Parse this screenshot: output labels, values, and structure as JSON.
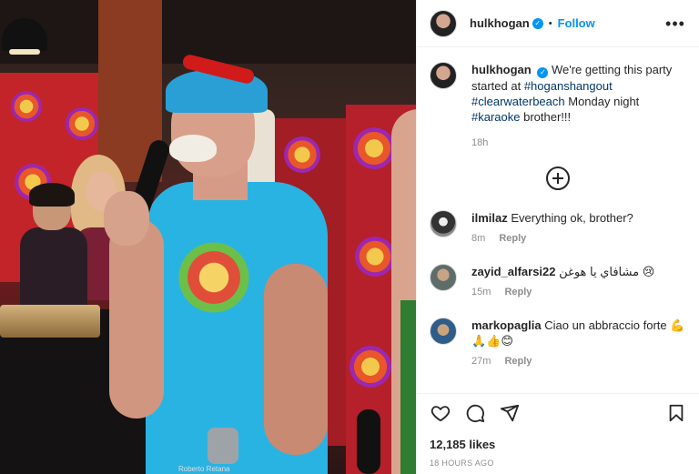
{
  "header": {
    "username": "hulkhogan",
    "separator": "•",
    "follow_label": "Follow",
    "more_glyph": "•••"
  },
  "caption": {
    "username": "hulkhogan",
    "text_before": "We're getting this party started at ",
    "tag1": "#hoganshangout",
    "tag2": "#clearwaterbeach",
    "text_middle": " Monday night ",
    "tag3": "#karaoke",
    "text_after": " brother!!!",
    "time": "18h"
  },
  "comments": [
    {
      "username": "ilmilaz",
      "text": "Everything ok, brother?",
      "time": "8m",
      "reply_label": "Reply"
    },
    {
      "username": "zayid_alfarsi22",
      "text": "مشافاي يا هوغن 😢",
      "time": "15m",
      "reply_label": "Reply"
    },
    {
      "username": "markopaglia",
      "text": "Ciao un abbraccio forte 💪🙏👍😊",
      "time": "27m",
      "reply_label": "Reply"
    }
  ],
  "footer": {
    "likes": "12,185 likes",
    "posted": "18 HOURS AGO"
  },
  "photo": {
    "credit": "Roberto Retana"
  },
  "icons": {
    "verified": "verified-badge-icon",
    "load_more": "plus-circle-icon",
    "like": "heart-icon",
    "comment": "comment-bubble-icon",
    "share": "paper-plane-icon",
    "save": "bookmark-icon"
  },
  "colors": {
    "accent": "#0095f6",
    "text": "#262626",
    "muted": "#8e8e8e",
    "hashtag": "#00376b"
  }
}
